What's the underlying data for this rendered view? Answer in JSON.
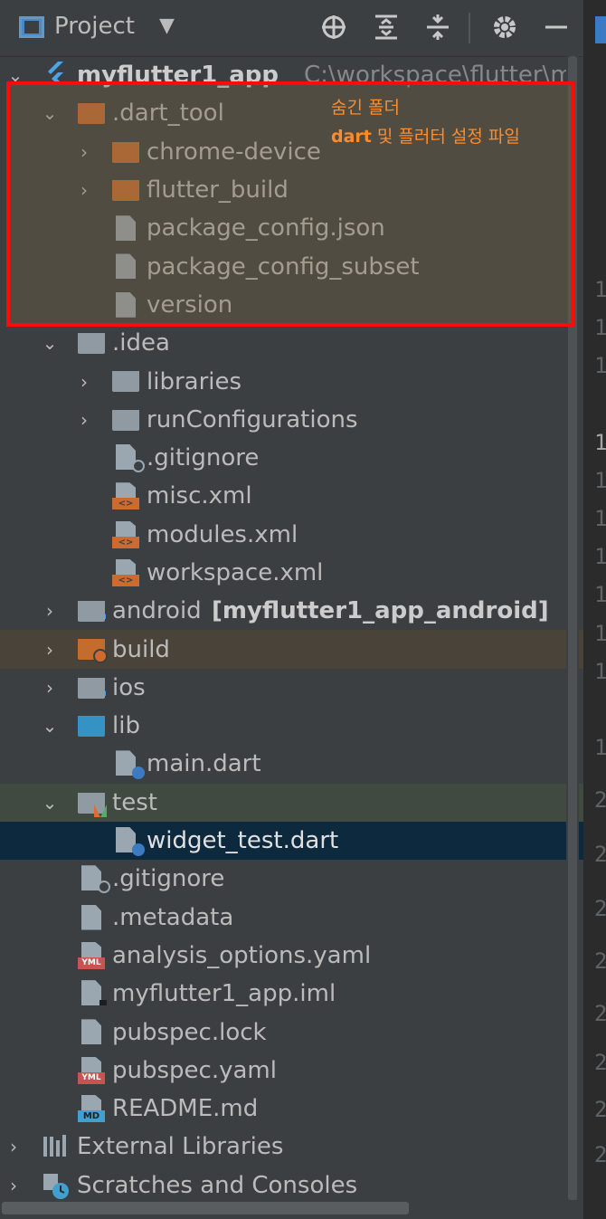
{
  "toolbar": {
    "title": "Project",
    "caret": "▼",
    "icons": [
      "crosshair-icon",
      "expand-all-icon",
      "collapse-all-icon",
      "gear-icon",
      "minimize-icon"
    ]
  },
  "annotation": {
    "line1": "숨긴 폴더",
    "line2_bold": "dart",
    "line2_rest": " 및 플러터 설정 파일"
  },
  "gutter_numbers": [
    "1",
    "1",
    "1",
    "1",
    "1",
    "1",
    "1",
    "1",
    "1",
    "1",
    "1",
    "2",
    "2",
    "2",
    "2",
    "2",
    "2",
    "2",
    "2",
    "2",
    "2"
  ],
  "tree": {
    "root": {
      "label": "myflutter1_app",
      "path": "C:\\workspace\\flutter\\m"
    },
    "dart_tool": ".dart_tool",
    "chrome_device": "chrome-device",
    "flutter_build": "flutter_build",
    "package_config_json": "package_config.json",
    "package_config_subset": "package_config_subset",
    "version": "version",
    "idea": ".idea",
    "libraries": "libraries",
    "run_configurations": "runConfigurations",
    "idea_gitignore": ".gitignore",
    "misc_xml": "misc.xml",
    "modules_xml": "modules.xml",
    "workspace_xml": "workspace.xml",
    "android": "android",
    "android_module": "[myflutter1_app_android]",
    "build": "build",
    "ios": "ios",
    "lib": "lib",
    "main_dart": "main.dart",
    "test": "test",
    "widget_test": "widget_test.dart",
    "gitignore": ".gitignore",
    "metadata": ".metadata",
    "analysis_options": "analysis_options.yaml",
    "iml": "myflutter1_app.iml",
    "pubspec_lock": "pubspec.lock",
    "pubspec_yaml": "pubspec.yaml",
    "readme": "README.md",
    "external_libraries": "External Libraries",
    "scratches": "Scratches and Consoles"
  },
  "file_tags": {
    "xml": "<>",
    "yml": "YML",
    "md": "MD"
  },
  "colors": {
    "selection": "#0d293e",
    "annotation_border": "#ff0a0a",
    "annotation_text": "#ff8c2a"
  }
}
